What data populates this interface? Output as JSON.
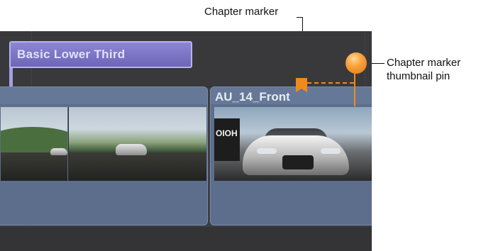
{
  "callouts": {
    "chapter_marker": "Chapter marker",
    "chapter_marker_thumbnail_pin": "Chapter marker thumbnail pin"
  },
  "timeline": {
    "title_clip": {
      "label": "Basic Lower Third",
      "color": "#7e77c8"
    },
    "clips": [
      {
        "name": "",
        "thumbnails": [
          "landscape-road",
          "landscape-car"
        ]
      },
      {
        "name": "AU_14_Front",
        "thumbnails": [
          "audi-front"
        ]
      }
    ],
    "marker_color": "#f08a1c"
  }
}
